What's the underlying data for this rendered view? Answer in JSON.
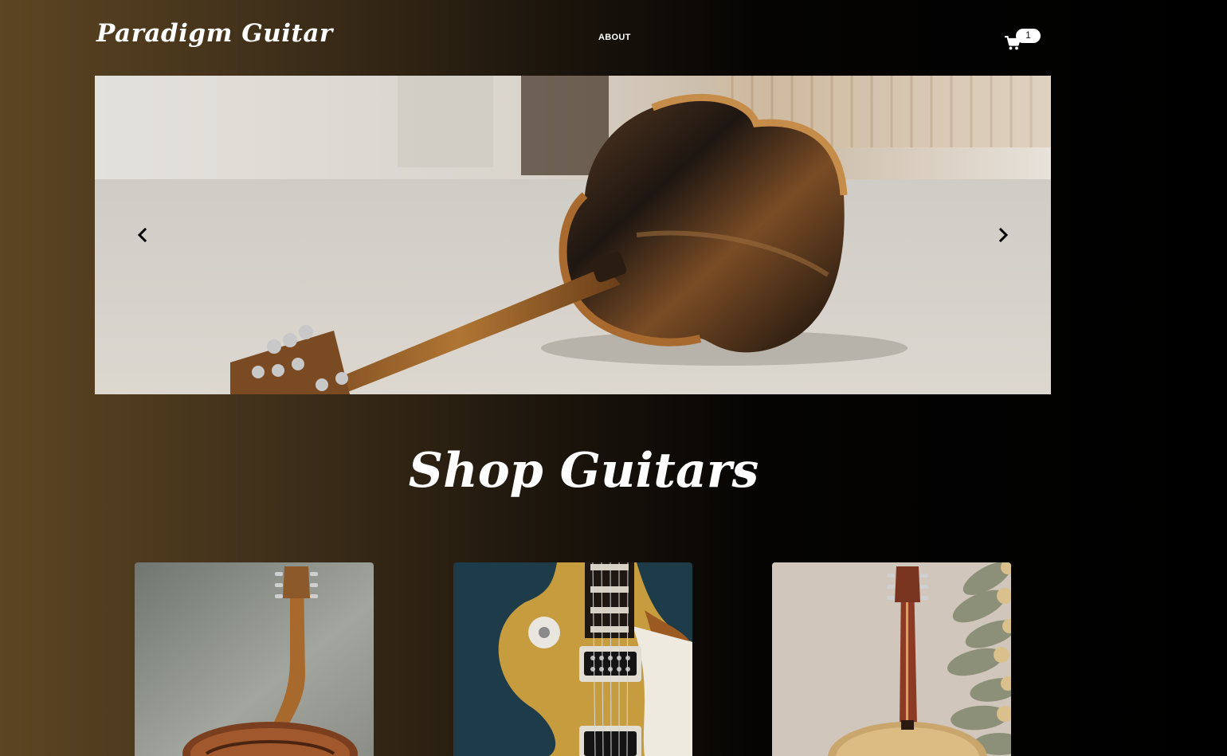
{
  "header": {
    "logo": "Paradigm Guitar",
    "nav": {
      "about": "ABOUT"
    },
    "cart": {
      "icon": "cart-icon",
      "count": "1"
    }
  },
  "carousel": {
    "slide_subject": "acoustic guitar lying on concrete floor",
    "prev_icon": "chevron-left-icon",
    "next_icon": "chevron-right-icon"
  },
  "shop": {
    "title": "Shop Guitars",
    "products": [
      {
        "subject": "acoustic guitar back on grey backdrop"
      },
      {
        "subject": "gold top electric guitar on dark teal backdrop"
      },
      {
        "subject": "acoustic guitar next to stacked logs"
      }
    ]
  },
  "colors": {
    "bg_left": "#5c4522",
    "bg_right": "#000000",
    "text": "#ffffff",
    "badge_bg": "#ffffff"
  }
}
